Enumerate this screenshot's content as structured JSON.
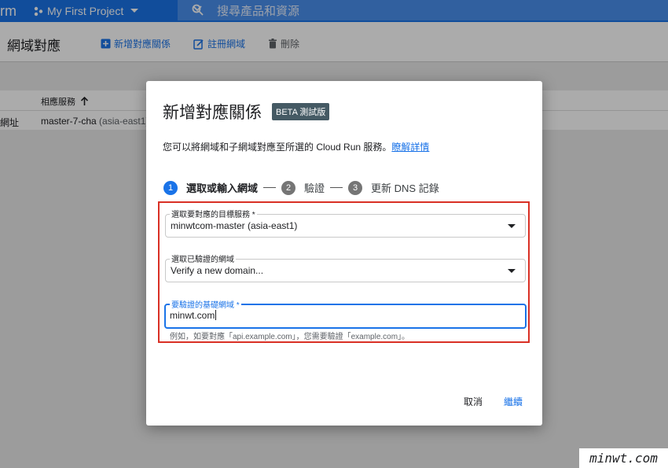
{
  "topbar": {
    "app_name": "rm",
    "project_name": "My First Project",
    "search_placeholder": "搜尋產品和資源"
  },
  "header": {
    "title": "網域對應",
    "actions": [
      {
        "label": "新增對應關係",
        "icon": "add-box-icon"
      },
      {
        "label": "註冊網域",
        "icon": "register-icon"
      },
      {
        "label": "刪除",
        "icon": "trash-icon"
      }
    ]
  },
  "table": {
    "col_service": "相應服務",
    "row": {
      "domain_partial": "網址",
      "service": "master-7-cha",
      "region": "(asia-east1)"
    }
  },
  "dialog": {
    "title": "新增對應關係",
    "badge": "BETA 測試版",
    "description": "您可以將網域和子網域對應至所選的 Cloud Run 服務。",
    "learn_more": "瞭解詳情",
    "steps": [
      {
        "number": "1",
        "label": "選取或輸入網域"
      },
      {
        "number": "2",
        "label": "驗證"
      },
      {
        "number": "3",
        "label": "更新 DNS 記錄"
      }
    ],
    "service_field": {
      "label": "選取要對應的目標服務 *",
      "value": "minwtcom-master (asia-east1)"
    },
    "domain_field": {
      "label": "選取已驗證的網域",
      "value": "Verify a new domain..."
    },
    "base_domain_field": {
      "label": "要驗證的基礎網域 *",
      "value": "minwt.com"
    },
    "hint": "例如，如要對應「api.example.com」，您需要驗證「example.com」。",
    "cancel": "取消",
    "continue": "繼續"
  },
  "watermark": "minwt.com",
  "colors": {
    "accent": "#1a73e8",
    "highlight": "#d93025",
    "badge": "#455a64"
  }
}
